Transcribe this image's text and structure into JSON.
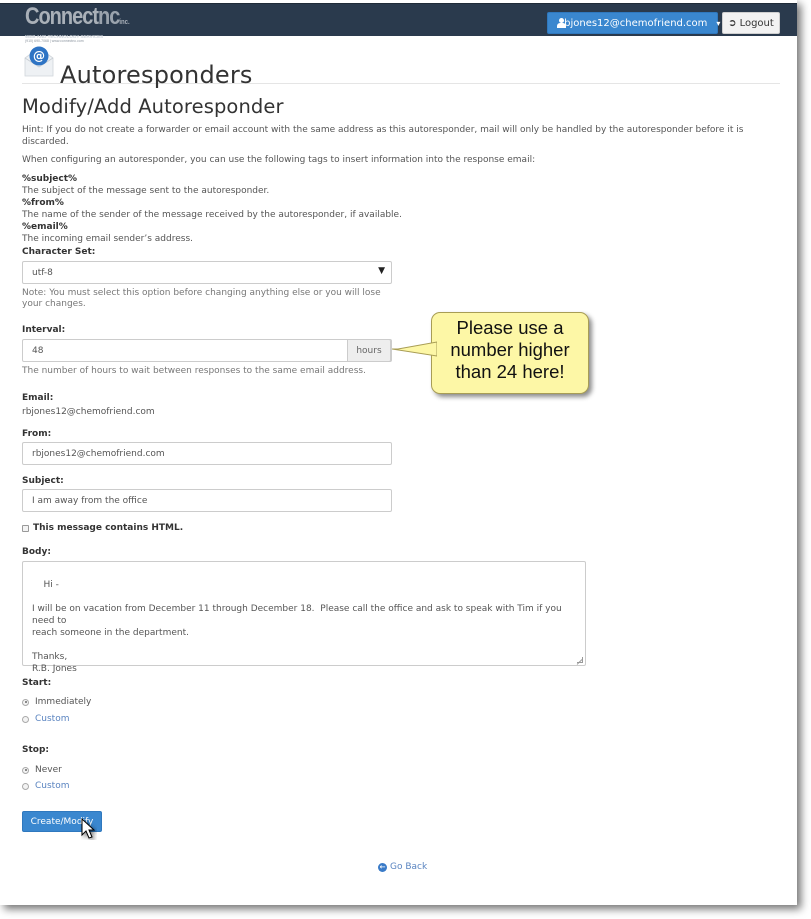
{
  "header": {
    "logo": {
      "brand_main": "Connect",
      "brand_accent": "nc",
      "brand_suffix": "inc.",
      "tagline": "WEB AND TECHNOLOGY SERVICES",
      "contact": "(910) 690-7068 | www.connectnc.com"
    },
    "user_menu_label": "rbjones12@chemofriend.com",
    "logout_label": "Logout"
  },
  "page": {
    "title": "Autoresponders"
  },
  "form": {
    "section_title": "Modify/Add Autoresponder",
    "hint": "Hint: If you do not create a forwarder or email account with the same address as this autoresponder, mail will only be handled by the autoresponder before it is discarded.",
    "tags_intro": "When configuring an autoresponder, you can use the following tags to insert information into the response email:",
    "tags": [
      {
        "tag": "%subject%",
        "description": "The subject of the message sent to the autoresponder."
      },
      {
        "tag": "%from%",
        "description": "The name of the sender of the message received by the autoresponder, if available."
      },
      {
        "tag": "%email%",
        "description": "The incoming email sender’s address."
      }
    ],
    "charset": {
      "label": "Character Set:",
      "value": "utf-8",
      "note": "Note: You must select this option before changing anything else or you will lose your changes."
    },
    "interval": {
      "label": "Interval:",
      "value": "48",
      "addon": "hours",
      "help": "The number of hours to wait between responses to the same email address."
    },
    "email": {
      "label": "Email:",
      "value": "rbjones12@chemofriend.com"
    },
    "from": {
      "label": "From:",
      "value": "rbjones12@chemofriend.com"
    },
    "subject": {
      "label": "Subject:",
      "value": "I am away from the office"
    },
    "html_checkbox": {
      "label": "This message contains HTML.",
      "checked": false
    },
    "body": {
      "label": "Body:",
      "value": "Hi -\n\nI will be on vacation from December 11 through December 18.  Please call the office and ask to speak with Tim if you need to\nreach someone in the department.\n\nThanks,\nR.B. Jones"
    },
    "start": {
      "label": "Start:",
      "options": [
        {
          "label": "Immediately",
          "selected": true
        },
        {
          "label": "Custom",
          "selected": false
        }
      ]
    },
    "stop": {
      "label": "Stop:",
      "options": [
        {
          "label": "Never",
          "selected": true
        },
        {
          "label": "Custom",
          "selected": false
        }
      ]
    },
    "submit_label": "Create/Modify",
    "go_back_label": "Go Back"
  },
  "annotation": {
    "callout_text": "Please use a\nnumber higher\nthan 24 here!"
  },
  "colors": {
    "topbar": "#2a3a4d",
    "primary": "#3a87cf",
    "link": "#5a84c0",
    "callout_bg": "#fdf7a6"
  }
}
